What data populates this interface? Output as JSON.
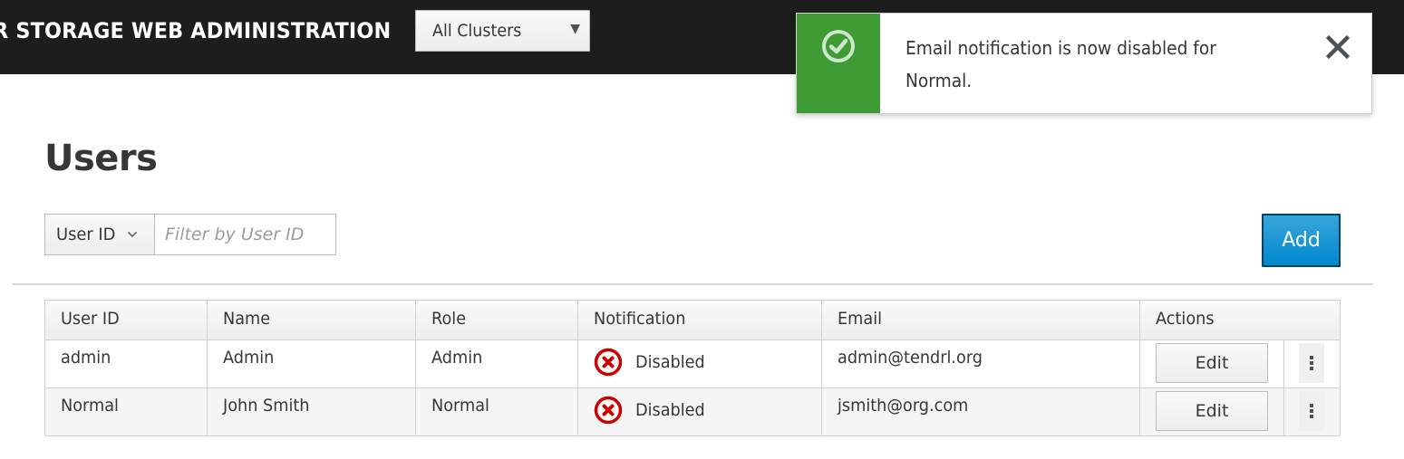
{
  "header": {
    "brand": "R STORAGE WEB ADMINISTRATION",
    "cluster_selector": {
      "selected": "All Clusters"
    }
  },
  "toast": {
    "type": "success",
    "message": "Email notification is now disabled for Normal.",
    "icon": "check-circle-icon",
    "close_icon": "close-icon",
    "accent_color": "#3f9c35"
  },
  "page": {
    "title": "Users"
  },
  "toolbar": {
    "filter_type": "User ID",
    "filter_placeholder": "Filter by User ID",
    "filter_value": "",
    "add_label": "Add"
  },
  "table": {
    "columns": [
      "User ID",
      "Name",
      "Role",
      "Notification",
      "Email",
      "Actions"
    ],
    "rows": [
      {
        "user_id": "admin",
        "name": "Admin",
        "role": "Admin",
        "notification": "Disabled",
        "notification_icon": "error-circle-icon",
        "email": "admin@tendrl.org",
        "edit_label": "Edit"
      },
      {
        "user_id": "Normal",
        "name": "John Smith",
        "role": "Normal",
        "notification": "Disabled",
        "notification_icon": "error-circle-icon",
        "email": "jsmith@org.com",
        "edit_label": "Edit"
      }
    ]
  },
  "colors": {
    "masthead": "#1d1d1d",
    "primary": "#0088ce",
    "error": "#cc0000",
    "success": "#3f9c35"
  }
}
